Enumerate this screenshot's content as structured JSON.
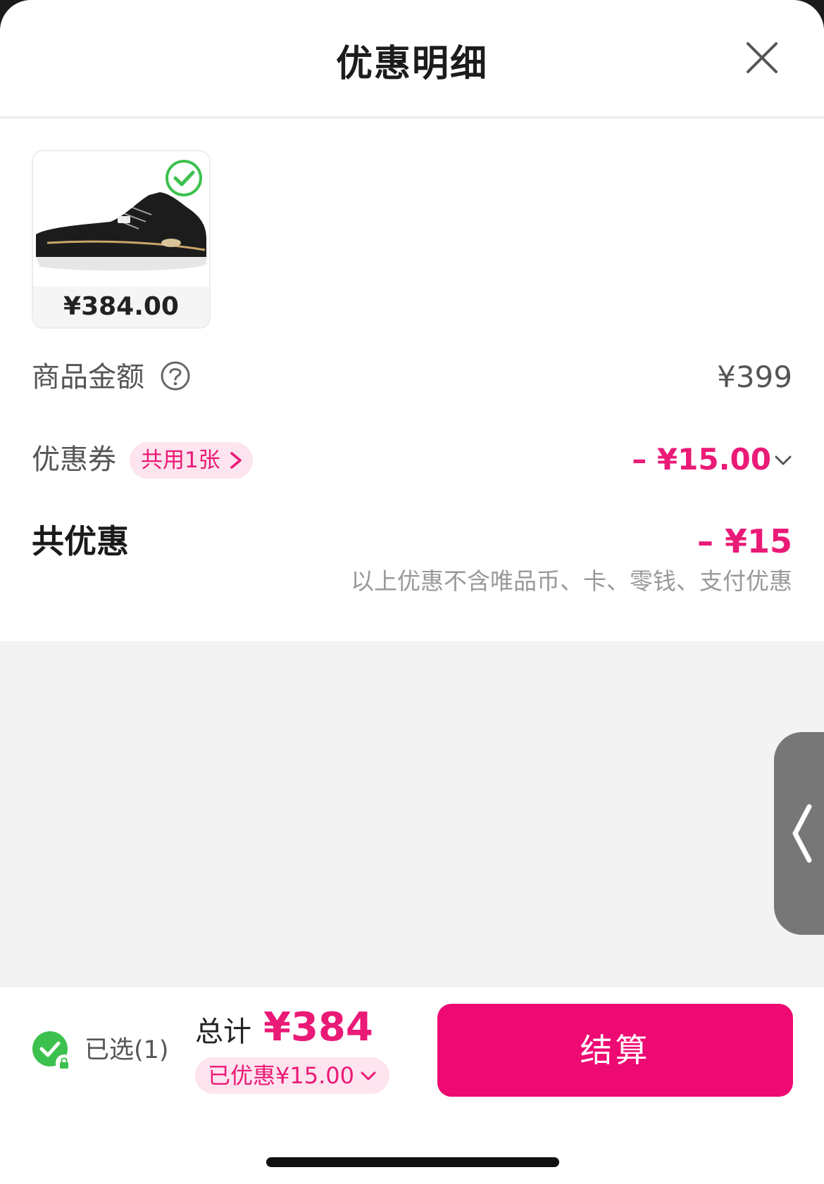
{
  "header": {
    "title": "优惠明细"
  },
  "product": {
    "price": "¥384.00",
    "image": "black running shoe",
    "selected": true
  },
  "rows": {
    "goods_amount": {
      "label": "商品金额",
      "value": "¥399"
    },
    "coupon": {
      "label": "优惠券",
      "chip": "共用1张",
      "value": "– ¥15.00"
    },
    "total_discount": {
      "label": "共优惠",
      "value": "– ¥15"
    },
    "note": "以上优惠不含唯品币、卡、零钱、支付优惠"
  },
  "bottom": {
    "selected": "已选(1)",
    "sum_label": "总计",
    "sum_value": "¥384",
    "saved": "已优惠¥15.00",
    "checkout": "结算"
  },
  "colors": {
    "accent": "#ee0a73",
    "chip_bg": "#fde4ee",
    "check_green": "#3cc14e"
  }
}
